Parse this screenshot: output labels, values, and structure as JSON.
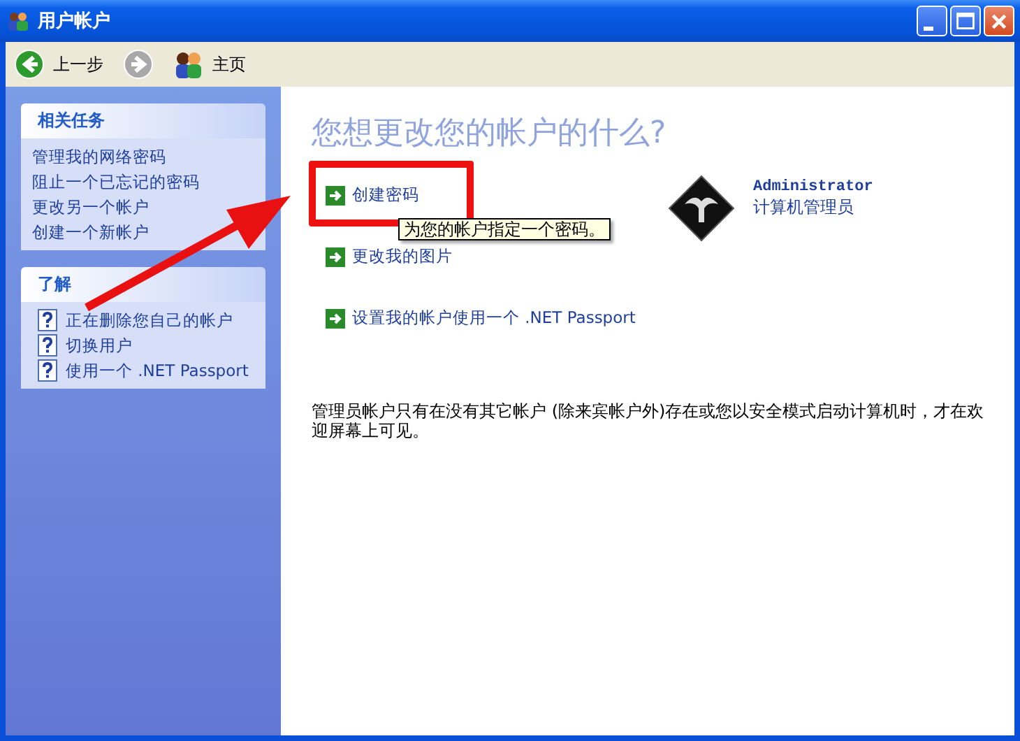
{
  "window": {
    "title": "用户帐户"
  },
  "toolbar": [
    {
      "kind": "back",
      "label": "上一步",
      "disabled": false
    },
    {
      "kind": "forward",
      "disabled": true
    },
    {
      "kind": "home",
      "label": "主页",
      "disabled": false
    }
  ],
  "sidebar": [
    {
      "kind": "tasks",
      "title": "相关任务",
      "items": [
        "管理我的网络密码",
        "阻止一个已忘记的密码",
        "更改另一个帐户",
        "创建一个新帐户"
      ]
    },
    {
      "kind": "help",
      "title": "了解",
      "items": [
        "正在删除您自己的帐户",
        "切换用户",
        "使用一个 .NET Passport"
      ]
    }
  ],
  "main": {
    "heading": "您想更改您的帐户的什么?",
    "links": [
      {
        "label": "创建密码",
        "highlighted": true
      },
      {
        "label": "更改我的图片",
        "highlighted": false
      },
      {
        "label": "设置我的帐户使用一个 .NET Passport",
        "highlighted": false
      }
    ],
    "tooltip": "为您的帐户指定一个密码。",
    "account": {
      "name": "Administrator",
      "role": "计算机管理员"
    },
    "note": "管理员帐户只有在没有其它帐户 (除来宾帐户外)存在或您以安全模式启动计算机时，才在欢迎屏幕上可见。"
  }
}
